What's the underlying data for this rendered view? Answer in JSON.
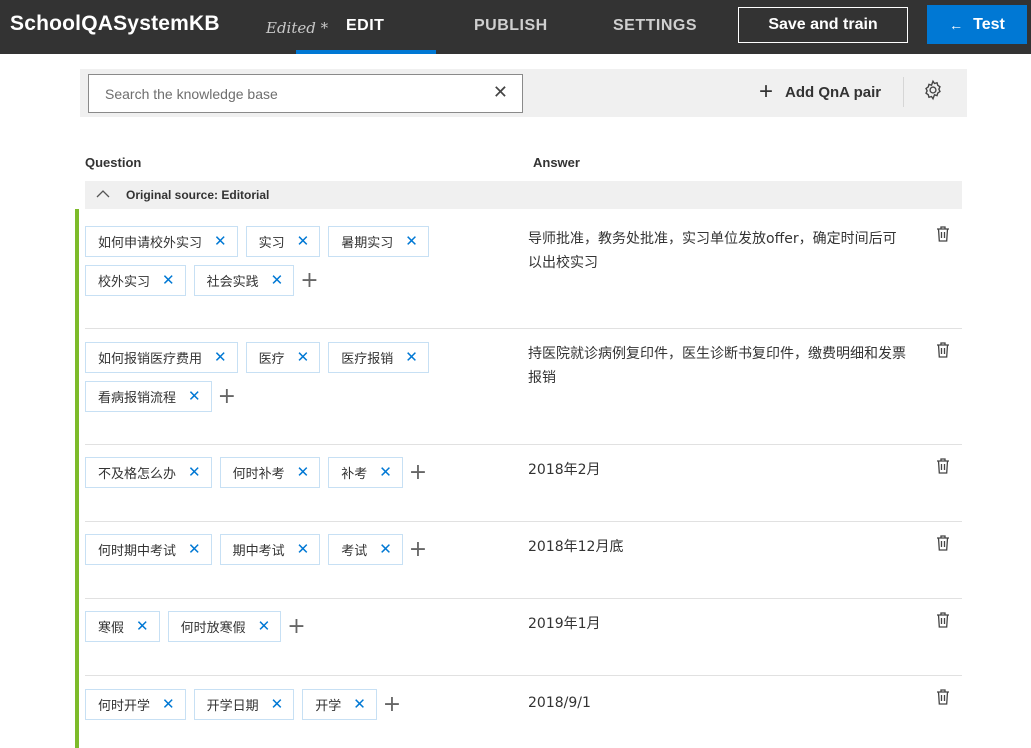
{
  "header": {
    "app_title": "SchoolQASystemKB",
    "edited_label": "Edited *",
    "tabs": [
      "EDIT",
      "PUBLISH",
      "SETTINGS"
    ],
    "active_tab": "EDIT",
    "save_label": "Save and train",
    "test_label": "Test",
    "test_icon": "arrow-left-icon",
    "accent_color": "#0078d4"
  },
  "toolbar": {
    "search_placeholder": "Search the knowledge base",
    "add_label": "Add QnA pair"
  },
  "columns": {
    "question": "Question",
    "answer": "Answer"
  },
  "source_label": "Original source: Editorial",
  "source_bar_color": "#7dbb2a",
  "qna": [
    {
      "questions": [
        "如何申请校外实习",
        "实习",
        "暑期实习",
        "校外实习",
        "社会实践"
      ],
      "answer": "导师批准，教务处批准，实习单位发放offer，确定时间后可以出校实习"
    },
    {
      "questions": [
        "如何报销医疗费用",
        "医疗",
        "医疗报销",
        "看病报销流程"
      ],
      "answer": "持医院就诊病例复印件，医生诊断书复印件，缴费明细和发票报销"
    },
    {
      "questions": [
        "不及格怎么办",
        "何时补考",
        "补考"
      ],
      "answer": "2018年2月"
    },
    {
      "questions": [
        "何时期中考试",
        "期中考试",
        "考试"
      ],
      "answer": "2018年12月底"
    },
    {
      "questions": [
        "寒假",
        "何时放寒假"
      ],
      "answer": "2019年1月"
    },
    {
      "questions": [
        "何时开学",
        "开学日期",
        "开学"
      ],
      "answer": "2018/9/1"
    }
  ]
}
